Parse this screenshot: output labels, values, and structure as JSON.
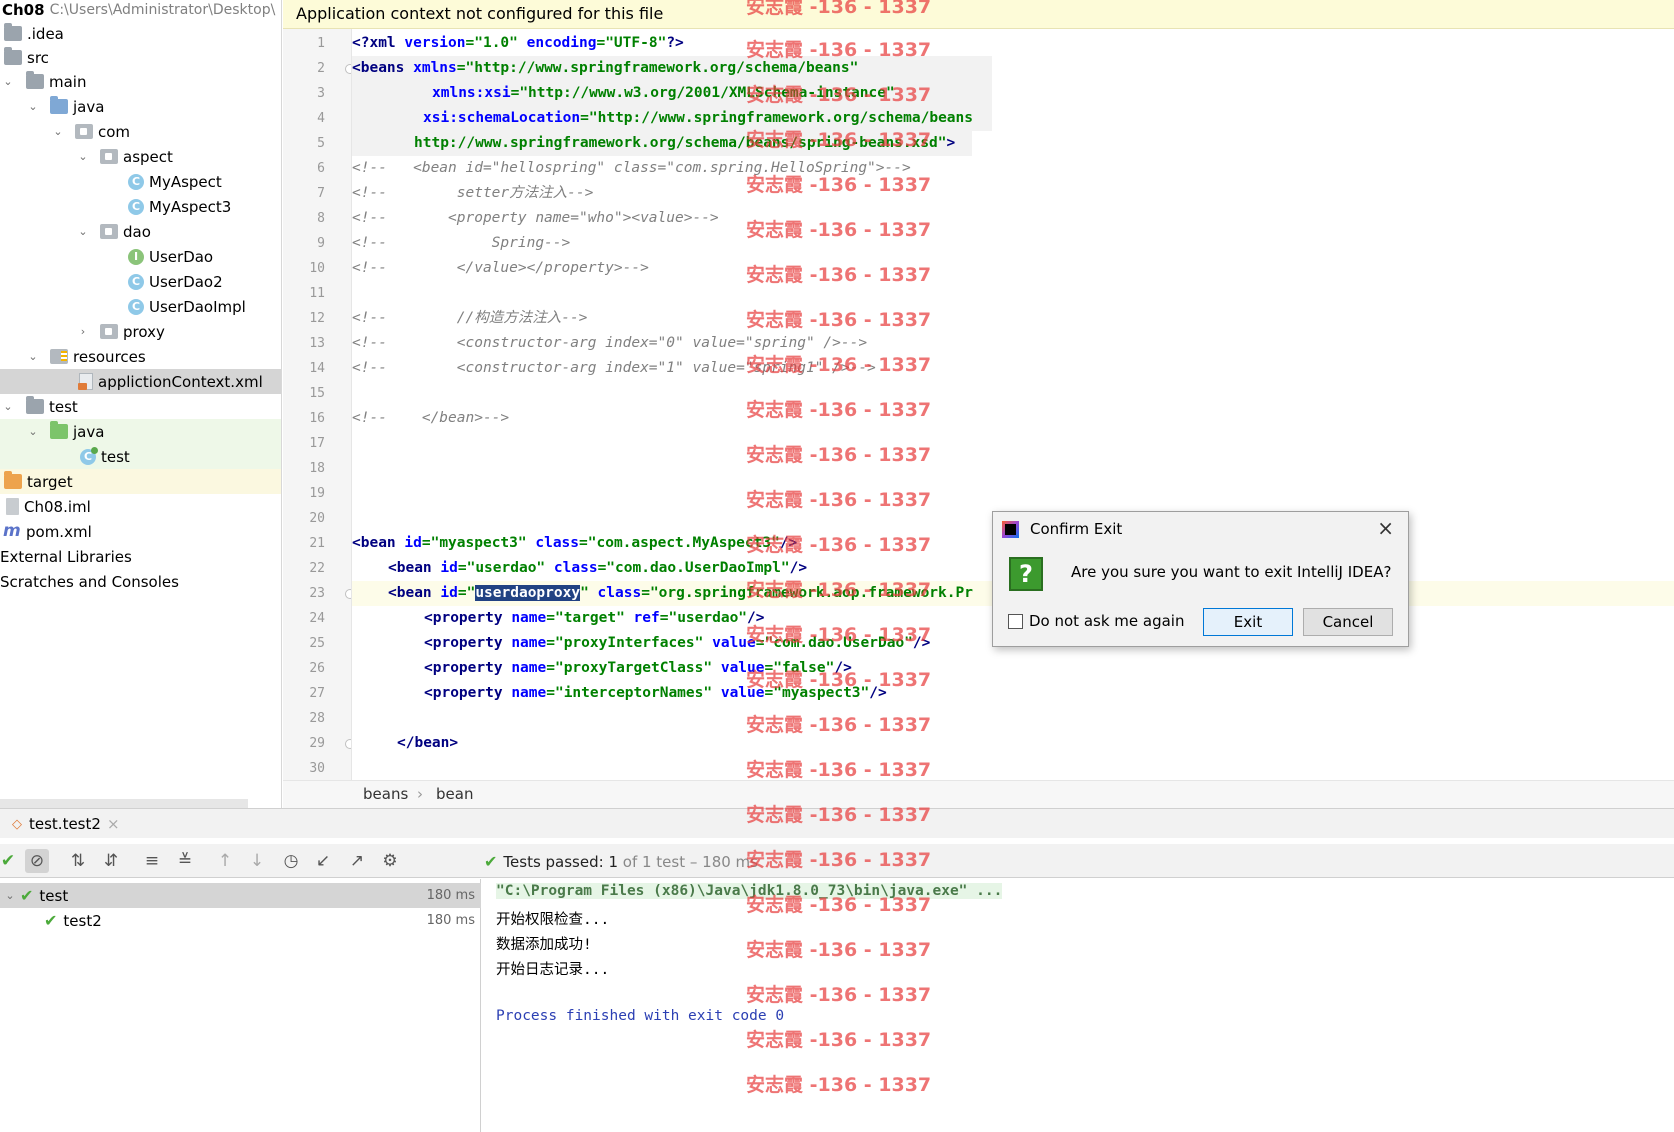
{
  "project": {
    "root_name": "Ch08",
    "root_path": "C:\\Users\\Administrator\\Desktop\\",
    "items": [
      {
        "label": ".idea"
      },
      {
        "label": "src"
      },
      {
        "label": "main"
      },
      {
        "label": "java"
      },
      {
        "label": "com"
      },
      {
        "label": "aspect"
      },
      {
        "label": "MyAspect"
      },
      {
        "label": "MyAspect3"
      },
      {
        "label": "dao"
      },
      {
        "label": "UserDao"
      },
      {
        "label": "UserDao2"
      },
      {
        "label": "UserDaoImpl"
      },
      {
        "label": "proxy"
      },
      {
        "label": "resources"
      },
      {
        "label": "applictionContext.xml"
      },
      {
        "label": "test"
      },
      {
        "label": "java"
      },
      {
        "label": "test"
      },
      {
        "label": "target"
      },
      {
        "label": "Ch08.iml"
      },
      {
        "label": "pom.xml"
      },
      {
        "label": "External Libraries"
      },
      {
        "label": "Scratches and Consoles"
      }
    ],
    "icons": {
      "class_letter": "C",
      "interface_letter": "I",
      "maven_letter": "m"
    }
  },
  "editor": {
    "banner": "Application context not configured for this file",
    "line_numbers": [
      "1",
      "2",
      "3",
      "4",
      "5",
      "6",
      "7",
      "8",
      "9",
      "10",
      "11",
      "12",
      "13",
      "14",
      "15",
      "16",
      "17",
      "18",
      "19",
      "20",
      "21",
      "22",
      "23",
      "24",
      "25",
      "26",
      "27",
      "28",
      "29",
      "30"
    ],
    "lines": {
      "l1": {
        "a": "<?xml ",
        "b": "version",
        "c": "=",
        "d": "\"1.0\"",
        "e": " ",
        "f": "encoding",
        "g": "=",
        "h": "\"UTF-8\"",
        "i": "?>"
      },
      "l2": {
        "a": "<beans ",
        "b": "xmlns",
        "c": "=",
        "d": "\"http://www.springframework.org/schema/beans\""
      },
      "l3": {
        "a": "xmlns:xsi",
        "b": "=",
        "c": "\"http://www.w3.org/2001/XMLSchema-instance\""
      },
      "l4": {
        "a": "xsi:schemaLocation",
        "b": "=",
        "c": "\"http://www.springframework.org/schema/beans"
      },
      "l5": {
        "a": "http://www.springframework.org/schema/beans/spring-beans.xsd\"",
        "b": ">"
      },
      "l6": "<!--   <bean id=\"hellospring\" class=\"com.spring.HelloSpring\">-->",
      "l7": "<!--        setter方法注入-->",
      "l8": "<!--       <property name=\"who\"><value>-->",
      "l9": "<!--            Spring-->",
      "l10": "<!--        </value></property>-->",
      "l12": "<!--        //构造方法注入-->",
      "l13": "<!--        <constructor-arg index=\"0\" value=\"spring\" />-->",
      "l14": "<!--        <constructor-arg index=\"1\" value=\"spring1\" />-->",
      "l16": "<!--    </bean>-->",
      "l21": {
        "a": "<bean ",
        "b": "id",
        "c": "=",
        "d": "\"myaspect3\"",
        "e": " class",
        "f": "=",
        "g": "\"com.aspect.MyAspect3\"",
        "h": "/>"
      },
      "l22": {
        "a": "<bean ",
        "b": "id",
        "c": "=",
        "d": "\"userdao\"",
        "e": " class",
        "f": "=",
        "g": "\"com.dao.UserDaoImpl\"",
        "h": "/>"
      },
      "l23": {
        "a": "<bean ",
        "b": "id",
        "c": "=\"",
        "d": "userdaoproxy",
        "e": "\"",
        "f": " class",
        "g": "=",
        "h": "\"org.springframework.aop.framework.Pr"
      },
      "l24": {
        "a": "<property ",
        "b": "name",
        "c": "=",
        "d": "\"target\"",
        "e": " ref",
        "f": "=",
        "g": "\"userdao\"",
        "h": "/>"
      },
      "l25": {
        "a": "<property ",
        "b": "name",
        "c": "=",
        "d": "\"proxyInterfaces\"",
        "e": " value",
        "f": "=",
        "g": "\"com.dao.UserDao\"",
        "h": "/>"
      },
      "l26": {
        "a": "<property ",
        "b": "name",
        "c": "=",
        "d": "\"proxyTargetClass\"",
        "e": " value",
        "f": "=",
        "g": "\"false\"",
        "h": "/>"
      },
      "l27": {
        "a": "<property ",
        "b": "name",
        "c": "=",
        "d": "\"interceptorNames\"",
        "e": " value",
        "f": "=",
        "g": "\"myaspect3\"",
        "h": "/>"
      },
      "l29": "</bean>"
    },
    "breadcrumb": {
      "first": "beans",
      "sep": "›",
      "second": "bean"
    }
  },
  "watermark": "安志霞 -136 - 1337",
  "run": {
    "tab_label": "test.test2",
    "tab_close": "×",
    "status": {
      "prefix": "Tests passed: ",
      "count": "1",
      "suffix": " of 1 test – 180 ms"
    },
    "tree": [
      {
        "label": "test",
        "time": "180 ms"
      },
      {
        "label": "test2",
        "time": "180 ms"
      }
    ],
    "console": [
      "\"C:\\Program Files (x86)\\Java\\jdk1.8.0_73\\bin\\java.exe\" ...",
      "开始权限检查...",
      "数据添加成功!",
      "开始日志记录...",
      "",
      "Process finished with exit code 0"
    ]
  },
  "dialog": {
    "title": "Confirm Exit",
    "close": "×",
    "message": "Are you sure you want to exit IntelliJ IDEA?",
    "question_mark": "?",
    "checkbox_label": "Do not ask me again",
    "exit_label": "Exit",
    "cancel_label": "Cancel"
  },
  "colors": {
    "tag": "#000080",
    "attr": "#0000ff",
    "string": "#008000",
    "comment": "#808080",
    "selection": "#214283"
  }
}
